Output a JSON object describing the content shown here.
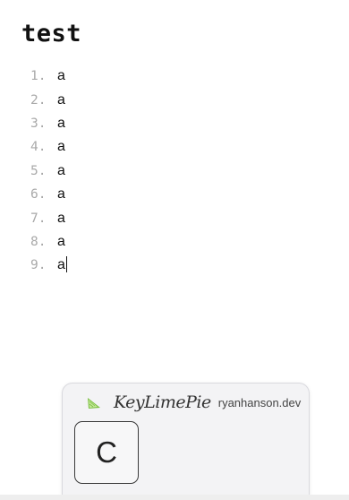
{
  "document": {
    "title": "test",
    "list_items": [
      {
        "number": "1.",
        "text": "a"
      },
      {
        "number": "2.",
        "text": "a"
      },
      {
        "number": "3.",
        "text": "a"
      },
      {
        "number": "4.",
        "text": "a"
      },
      {
        "number": "5.",
        "text": "a"
      },
      {
        "number": "6.",
        "text": "a"
      },
      {
        "number": "7.",
        "text": "a"
      },
      {
        "number": "8.",
        "text": "a"
      },
      {
        "number": "9.",
        "text": "a"
      }
    ]
  },
  "overlay": {
    "brand": "KeyLimePie",
    "site": "ryanhanson.dev",
    "icon": "lime-slice-icon",
    "key_pressed": "C"
  },
  "colors": {
    "list_number": "#a9a9a9",
    "text": "#111111",
    "overlay_bg": "#f3f3f5",
    "lime_green": "#7bc043"
  }
}
